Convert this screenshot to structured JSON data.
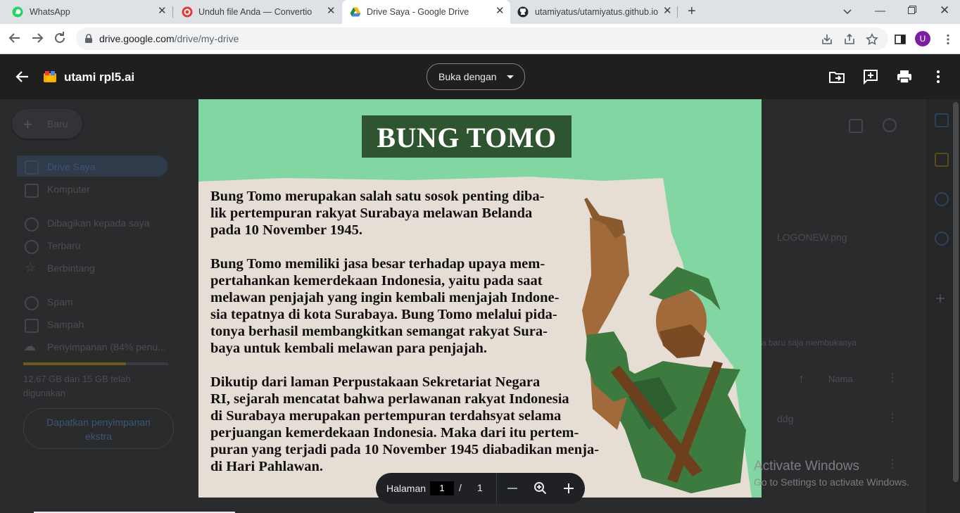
{
  "browser": {
    "tabs": [
      {
        "title": "WhatsApp",
        "icon": "whatsapp-icon"
      },
      {
        "title": "Unduh file Anda — Convertio",
        "icon": "convertio-icon"
      },
      {
        "title": "Drive Saya - Google Drive",
        "icon": "google-drive-icon",
        "active": true
      },
      {
        "title": "utamiyatus/utamiyatus.github.io",
        "icon": "github-icon"
      }
    ],
    "url_host": "drive.google.com",
    "url_path": "/drive/my-drive",
    "profile_initial": "U"
  },
  "drive": {
    "new_label": "Baru",
    "nav": [
      "Drive Saya",
      "Komputer",
      "Dibagikan kepada saya",
      "Terbaru",
      "Berbintang",
      "Spam",
      "Sampah",
      "Penyimpanan (84% penu..."
    ],
    "storage_text_1": "12,67 GB dari 15 GB telah",
    "storage_text_2": "digunakan",
    "get_storage_1": "Dapatkan penyimpanan",
    "get_storage_2": "ekstra",
    "recent_file": "LOGONEW.png",
    "recent_caption": "a baru saja membukanya",
    "sort_label": "Nama",
    "file_name": "ddg"
  },
  "viewer": {
    "file_title": "utami rpl5.ai",
    "open_with": "Buka dengan",
    "page_label": "Halaman",
    "page_current": "1",
    "page_sep": "/",
    "page_total": "1"
  },
  "poster": {
    "title": "BUNG TOMO",
    "paragraphs": [
      "Bung Tomo merupakan salah satu sosok penting diba-\nlik pertempuran rakyat Surabaya melawan Belanda\npada 10 November 1945.",
      "Bung Tomo memiliki jasa besar terhadap upaya mem-\npertahankan kemerdekaan Indonesia, yaitu pada saat\nmelawan penjajah yang ingin kembali menjajah Indone-\nsia tepatnya di kota Surabaya. Bung Tomo melalui pida-\ntonya berhasil membangkitkan semangat rakyat Sura-\nbaya untuk kembali melawan para penjajah.",
      "Dikutip dari laman Perpustakaan Sekretariat Negara\nRI, sejarah mencatat bahwa perlawanan rakyat Indonesia\ndi Surabaya merupakan pertempuran terdahsyat selama\nperjuangan kemerdekaan Indonesia. Maka dari itu pertem-\npuran yang terjadi pada 10 November 1945 diabadikan menja-\ndi Hari Pahlawan."
    ],
    "colors": {
      "background": "#81d6a1",
      "paper": "#e6ded4",
      "title_box": "#2f5430"
    }
  },
  "watermark": {
    "line1": "Activate Windows",
    "line2": "Go to Settings to activate Windows."
  }
}
